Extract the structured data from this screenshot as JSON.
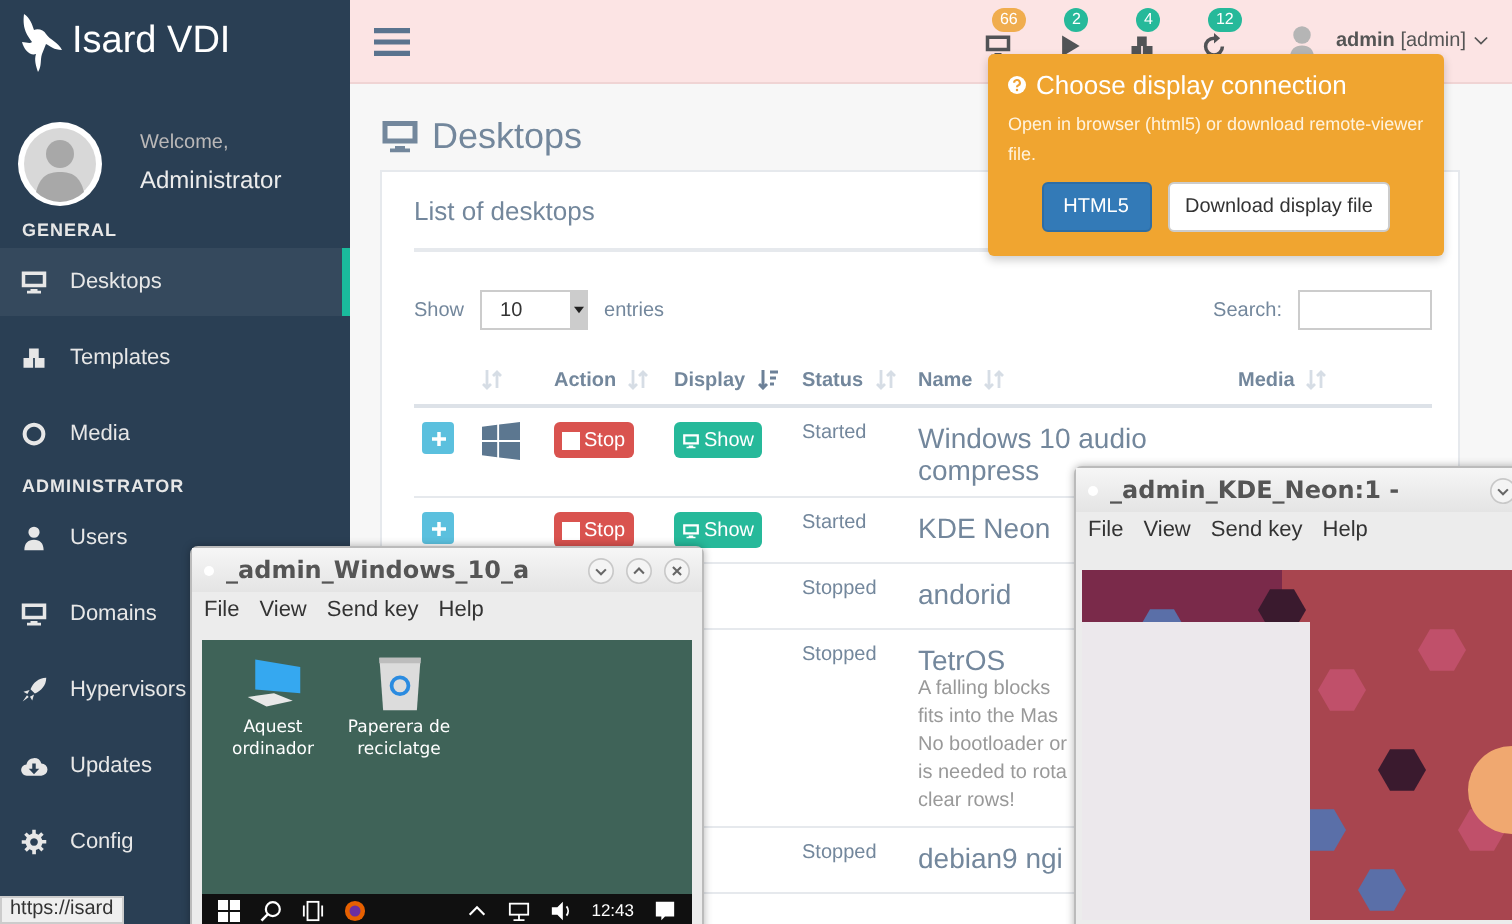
{
  "sidebar": {
    "logo": "Isard VDI",
    "welcome": "Welcome,",
    "user": "Administrator",
    "sections": [
      {
        "title": "GENERAL",
        "items": [
          {
            "label": "Desktops",
            "kind": "monitor",
            "selected": true
          },
          {
            "label": "Templates",
            "kind": "cubes",
            "selected": false
          },
          {
            "label": "Media",
            "kind": "ring",
            "selected": false
          }
        ]
      },
      {
        "title": "ADMINISTRATOR",
        "items": [
          {
            "label": "Users",
            "kind": "user",
            "selected": false
          },
          {
            "label": "Domains",
            "kind": "monitor",
            "selected": false
          },
          {
            "label": "Hypervisors",
            "kind": "rocket",
            "selected": false
          },
          {
            "label": "Updates",
            "kind": "cloud",
            "selected": false
          },
          {
            "label": "Config",
            "kind": "gear",
            "selected": false
          }
        ]
      }
    ]
  },
  "topbar": {
    "notifications": [
      {
        "kind": "monitor",
        "count": "66",
        "color": "#f0ad4e"
      },
      {
        "kind": "play",
        "count": "2",
        "color": "#26b99a"
      },
      {
        "kind": "cubes",
        "count": "4",
        "color": "#26b99a"
      },
      {
        "kind": "refresh",
        "count": "12",
        "color": "#26b99a"
      }
    ],
    "user": "admin",
    "role": "[admin]"
  },
  "page": {
    "title": "Desktops"
  },
  "card": {
    "title": "List of desktops",
    "show": "Show",
    "length": "10",
    "entries": "entries",
    "search": "Search:"
  },
  "table": {
    "columns": [
      {
        "sorted": false
      },
      {
        "label": "Action",
        "sorted": false
      },
      {
        "label": "Display",
        "sorted": true
      },
      {
        "label": "Status",
        "sorted": false
      },
      {
        "label": "Name",
        "sorted": false
      },
      {
        "label": "Media",
        "sorted": false
      }
    ],
    "rows": [
      {
        "expand": true,
        "logo": true,
        "action": "Stop",
        "display": "Show",
        "status": "Started",
        "name": "Windows 10 audio compress"
      },
      {
        "expand": true,
        "action": "Stop",
        "display": "Show",
        "status": "Started",
        "name": "KDE Neon"
      },
      {
        "status": "Stopped",
        "name": "andorid"
      },
      {
        "status": "Stopped",
        "name": "TetrOS",
        "description": [
          "A falling blocks",
          "fits into the Mas",
          "No bootloader or",
          "is needed to rota",
          "clear rows!"
        ]
      },
      {
        "status": "Stopped",
        "name": "debian9 ngi"
      }
    ]
  },
  "popover": {
    "title": "Choose display connection",
    "text": "Open in browser (html5) or download remote-viewer file.",
    "buttons": [
      {
        "label": "HTML5",
        "kind": "primary"
      },
      {
        "label": "Download display file",
        "kind": "default"
      }
    ]
  },
  "windows": [
    {
      "kind": "windows",
      "title": "_admin_Windows_10_a",
      "menu": [
        "File",
        "View",
        "Send key",
        "Help"
      ],
      "desktop_icons": [
        {
          "kind": "computer",
          "label": "Aquest ordinador"
        },
        {
          "kind": "bin",
          "label": "Paperera de reciclatge"
        }
      ],
      "clock": "12:43"
    },
    {
      "kind": "kde",
      "title": "_admin_KDE_Neon:1 -",
      "menu": [
        "File",
        "View",
        "Send key",
        "Help"
      ]
    }
  ],
  "status_url": "https://isard"
}
